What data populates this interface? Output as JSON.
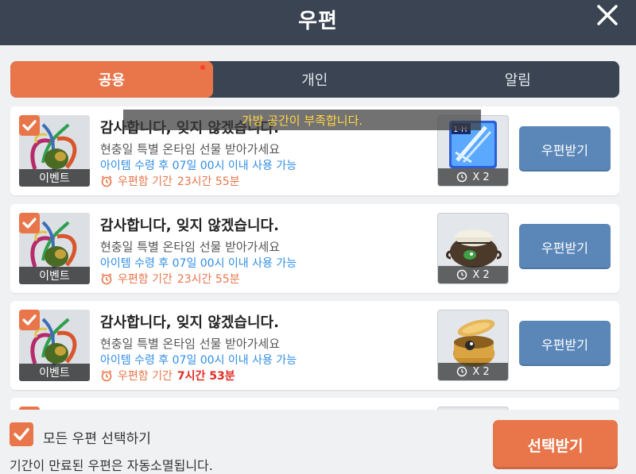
{
  "header": {
    "title": "우편",
    "close_icon": "close-icon"
  },
  "tabs": [
    {
      "label": "공용",
      "active": true,
      "has_notification": true
    },
    {
      "label": "개인",
      "active": false
    },
    {
      "label": "알림",
      "active": false
    }
  ],
  "toast": "가방 공간이 부족합니다.",
  "mails": [
    {
      "checked": true,
      "badge": "이벤트",
      "title": "감사합니다, 잊지 않겠습니다.",
      "subtitle": "현충일 특별 온타임 선물 받아가세요",
      "note": "아이템 수령 후 07일 00시 이내 사용 가능",
      "expiry_label": "우편함 기간",
      "expiry_value": "23시간 55분",
      "expiry_urgent": false,
      "item_icon": "one-hand-weapon-scroll-icon",
      "quantity": "X 2",
      "receive_label": "우편받기"
    },
    {
      "checked": true,
      "badge": "이벤트",
      "title": "감사합니다, 잊지 않겠습니다.",
      "subtitle": "현충일 특별 온타임 선물 받아가세요",
      "note": "아이템 수령 후 07일 00시 이내 사용 가능",
      "expiry_label": "우편함 기간",
      "expiry_value": "23시간 55분",
      "expiry_urgent": false,
      "item_icon": "cloth-pot-icon",
      "quantity": "X 2",
      "receive_label": "우편받기"
    },
    {
      "checked": true,
      "badge": "이벤트",
      "title": "감사합니다, 잊지 않겠습니다.",
      "subtitle": "현충일 특별 온타임 선물 받아가세요",
      "note": "아이템 수령 후 07일 00시 이내 사용 가능",
      "expiry_label": "우편함 기간",
      "expiry_value": "7시간 53분",
      "expiry_urgent": true,
      "item_icon": "golden-pot-icon",
      "quantity": "X 2",
      "receive_label": "우편받기"
    }
  ],
  "footer": {
    "select_all_label": "모든 우편 선택하기",
    "select_all_checked": true,
    "expire_note": "기간이 만료된 우편은 자동소멸됩니다.",
    "select_receive_label": "선택받기"
  },
  "colors": {
    "header_bg": "#3a4452",
    "accent": "#e8764a",
    "receive_button": "#5a87b8",
    "note_blue": "#2f8ee6",
    "urgent_red": "#e02c24",
    "toast_text": "#ffd646"
  }
}
